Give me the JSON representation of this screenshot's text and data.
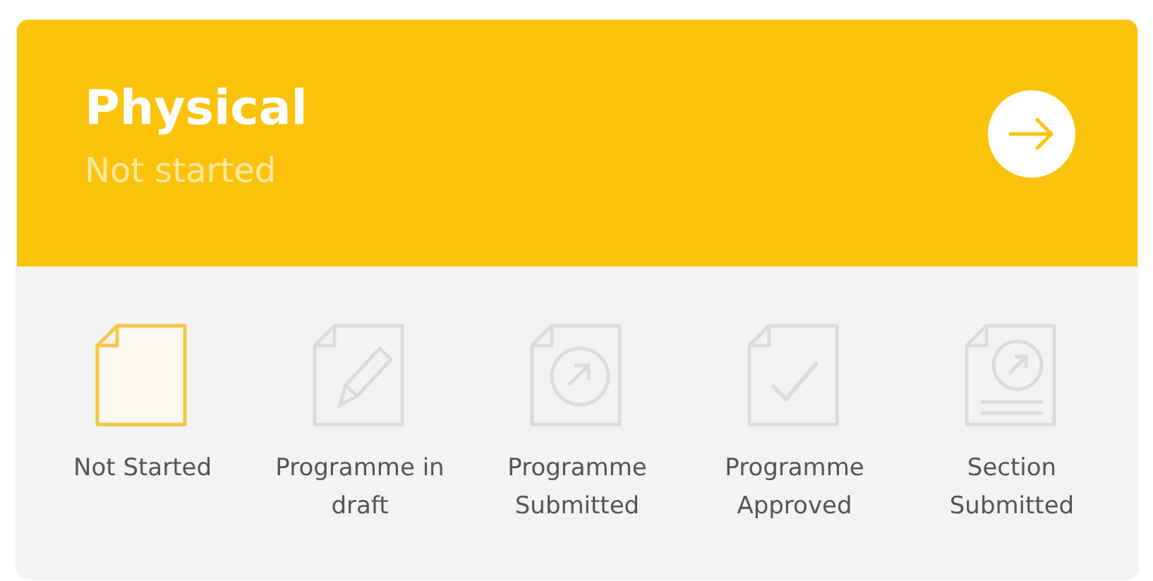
{
  "card": {
    "title": "Physical",
    "status": "Not started"
  },
  "stages": [
    {
      "kind": "page",
      "label": "Not Started",
      "selected": true
    },
    {
      "kind": "pencil",
      "label": "Programme in draft",
      "selected": false
    },
    {
      "kind": "submit",
      "label": "Programme Submitted",
      "selected": false
    },
    {
      "kind": "check",
      "label": "Programme Approved",
      "selected": false
    },
    {
      "kind": "section",
      "label": "Section Submitted",
      "selected": false
    }
  ]
}
